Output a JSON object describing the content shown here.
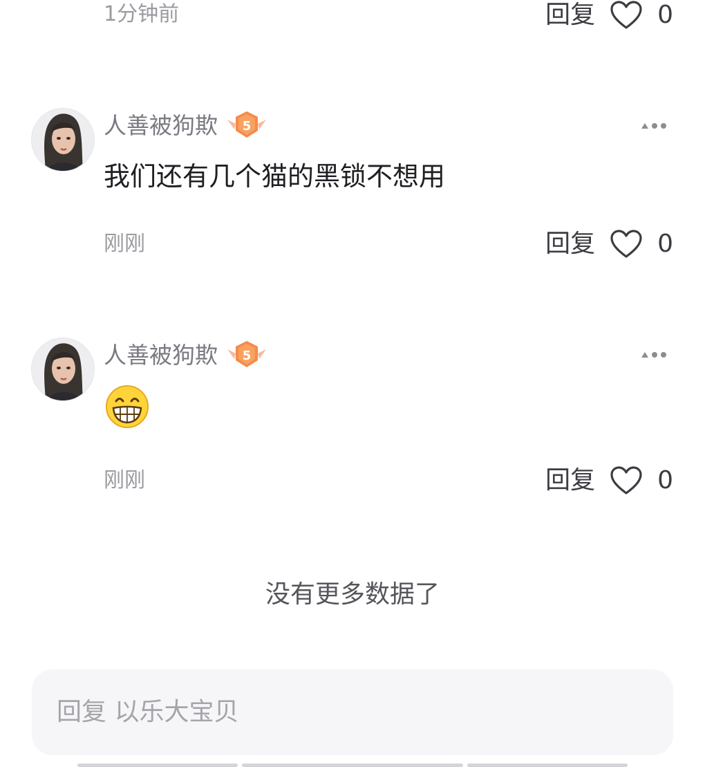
{
  "top_comment": {
    "time": "1分钟前",
    "reply_label": "回复",
    "like_count": "0"
  },
  "comments": [
    {
      "username": "人善被狗欺",
      "level": "5",
      "content": "我们还有几个猫的黑锁不想用",
      "time": "刚刚",
      "reply_label": "回复",
      "like_count": "0"
    },
    {
      "username": "人善被狗欺",
      "level": "5",
      "content_emoji": "grinning-emoji",
      "time": "刚刚",
      "reply_label": "回复",
      "like_count": "0"
    }
  ],
  "list_end_text": "没有更多数据了",
  "reply_input": {
    "placeholder": "回复 以乐大宝贝"
  },
  "colors": {
    "badge_orange": "#f58a4b",
    "text_primary": "#1f1f23",
    "text_secondary": "#9a9aa0",
    "input_bg": "#f6f6f8"
  }
}
